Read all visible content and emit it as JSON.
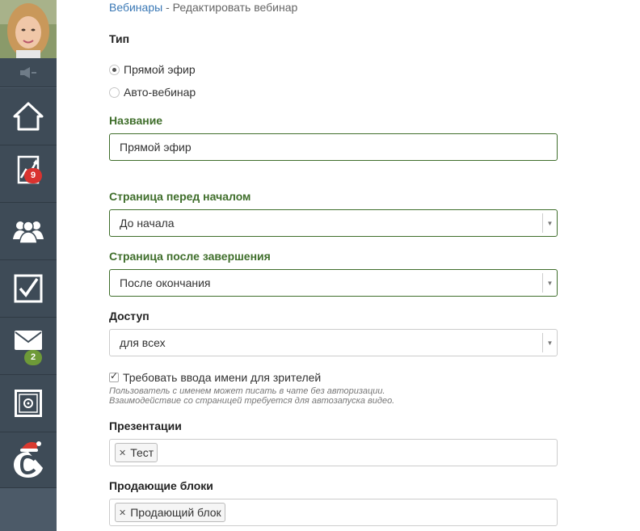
{
  "sidebar": {
    "badges": {
      "stats": "9",
      "messages": "2"
    },
    "icons": [
      "avatar",
      "speaker-icon",
      "home-icon",
      "chart-icon",
      "users-icon",
      "tasks-icon",
      "mail-icon",
      "safe-icon",
      "logo-c-icon"
    ]
  },
  "breadcrumb": {
    "link": "Вебинары",
    "separator": "-",
    "current": "Редактировать вебинар"
  },
  "form": {
    "type_label": "Тип",
    "type_options": [
      {
        "label": "Прямой эфир",
        "checked": true
      },
      {
        "label": "Авто-вебинар",
        "checked": false
      }
    ],
    "name_label": "Название",
    "name_value": "Прямой эфир",
    "before_label": "Страница перед началом",
    "before_value": "До начала",
    "after_label": "Страница после завершения",
    "after_value": "После окончания",
    "access_label": "Доступ",
    "access_value": "для всех",
    "require_name_label": "Требовать ввода имени для зрителей",
    "require_name_checked": true,
    "hint_line1": "Пользователь с именем может писать в чате без авторизации.",
    "hint_line2": "Взаимодействие со страницей требуется для автозапуска видео.",
    "presentations_label": "Презентации",
    "presentations_tags": [
      "Тест"
    ],
    "blocks_label": "Продающие блоки",
    "blocks_tags": [
      "Продающий блок"
    ]
  },
  "colors": {
    "sidebar": "#3e4b57",
    "green_label": "#3f6e2b",
    "link": "#3a78b5",
    "badge_red": "#d9332f",
    "badge_green": "#6e9a38"
  }
}
